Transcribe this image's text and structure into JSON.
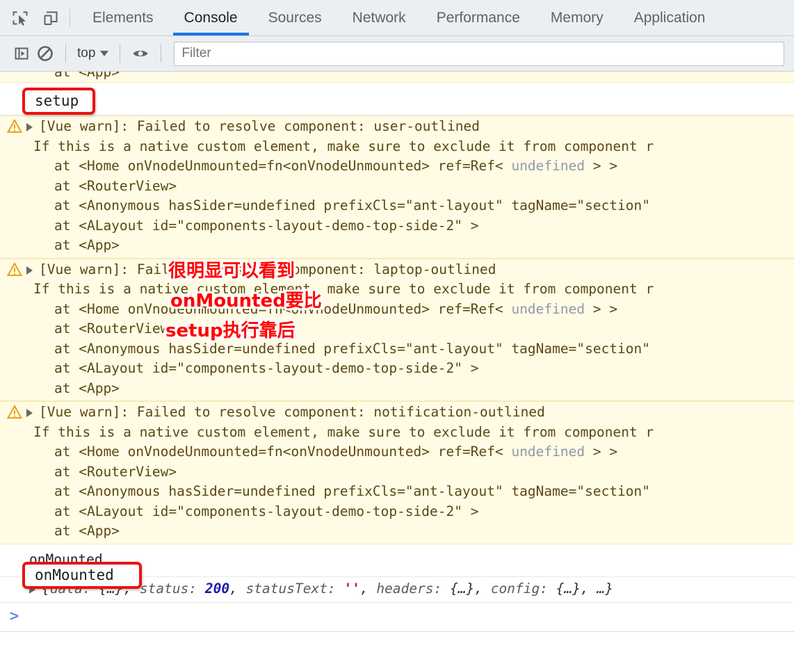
{
  "devtools": {
    "icons": {
      "inspect": "inspect-element-icon",
      "device": "device-toolbar-icon"
    },
    "tabs": [
      {
        "label": "Elements",
        "active": false
      },
      {
        "label": "Console",
        "active": true
      },
      {
        "label": "Sources",
        "active": false
      },
      {
        "label": "Network",
        "active": false
      },
      {
        "label": "Performance",
        "active": false
      },
      {
        "label": "Memory",
        "active": false
      },
      {
        "label": "Application",
        "active": false
      }
    ]
  },
  "console_toolbar": {
    "execute_label": "sidebar-toggle-icon",
    "clear_label": "clear-console-icon",
    "context": "top",
    "eye_label": "live-expression-icon",
    "filter_placeholder": "Filter",
    "filter_value": ""
  },
  "console": {
    "clipped_top_line": "at <App>",
    "setup_log": "setup",
    "warnings": [
      {
        "head": "[Vue warn]: Failed to resolve component: user-outlined",
        "detail": "If this is a native custom element, make sure to exclude it from component r",
        "stack": [
          {
            "pre": "at <Home onVnodeUnmounted=fn<onVnodeUnmounted> ref=Ref< ",
            "token": "undefined",
            "post": " > >"
          },
          {
            "pre": "at <RouterView>",
            "token": "",
            "post": ""
          },
          {
            "pre": "at <Anonymous hasSider=undefined prefixCls=\"ant-layout\" tagName=\"section\"",
            "token": "",
            "post": ""
          },
          {
            "pre": "at <ALayout id=\"components-layout-demo-top-side-2\" >",
            "token": "",
            "post": ""
          },
          {
            "pre": "at <App>",
            "token": "",
            "post": ""
          }
        ]
      },
      {
        "head": "[Vue warn]: Failed to resolve component: laptop-outlined",
        "detail": "If this is a native custom element, make sure to exclude it from component r",
        "stack": [
          {
            "pre": "at <Home onVnodeUnmounted=fn<onVnodeUnmounted> ref=Ref< ",
            "token": "undefined",
            "post": " > >"
          },
          {
            "pre": "at <RouterView>",
            "token": "",
            "post": ""
          },
          {
            "pre": "at <Anonymous hasSider=undefined prefixCls=\"ant-layout\" tagName=\"section\"",
            "token": "",
            "post": ""
          },
          {
            "pre": "at <ALayout id=\"components-layout-demo-top-side-2\" >",
            "token": "",
            "post": ""
          },
          {
            "pre": "at <App>",
            "token": "",
            "post": ""
          }
        ]
      },
      {
        "head": "[Vue warn]: Failed to resolve component: notification-outlined",
        "detail": "If this is a native custom element, make sure to exclude it from component r",
        "stack": [
          {
            "pre": "at <Home onVnodeUnmounted=fn<onVnodeUnmounted> ref=Ref< ",
            "token": "undefined",
            "post": " > >"
          },
          {
            "pre": "at <RouterView>",
            "token": "",
            "post": ""
          },
          {
            "pre": "at <Anonymous hasSider=undefined prefixCls=\"ant-layout\" tagName=\"section\"",
            "token": "",
            "post": ""
          },
          {
            "pre": "at <ALayout id=\"components-layout-demo-top-side-2\" >",
            "token": "",
            "post": ""
          },
          {
            "pre": "at <App>",
            "token": "",
            "post": ""
          }
        ]
      }
    ],
    "onmounted_log": "onMounted",
    "object_preview": {
      "open": "{",
      "k1": "data: ",
      "v1": "{…}",
      "sep1": ", ",
      "k2": "status: ",
      "v2": "200",
      "sep2": ", ",
      "k3": "statusText: ",
      "v3": "''",
      "sep3": ", ",
      "k4": "headers: ",
      "v4": "{…}",
      "sep4": ", ",
      "k5": "config: ",
      "v5": "{…}",
      "sep5": ", ",
      "ellipsis": "…",
      "close": "}"
    },
    "prompt_caret": ">"
  },
  "annotations": {
    "box_setup": "setup",
    "box_onmounted": "onMounted",
    "cn_line1": "很明显可以看到",
    "cn_line2": "onMounted要比",
    "cn_line3": "setup执行靠后",
    "red": "#ff0000"
  }
}
